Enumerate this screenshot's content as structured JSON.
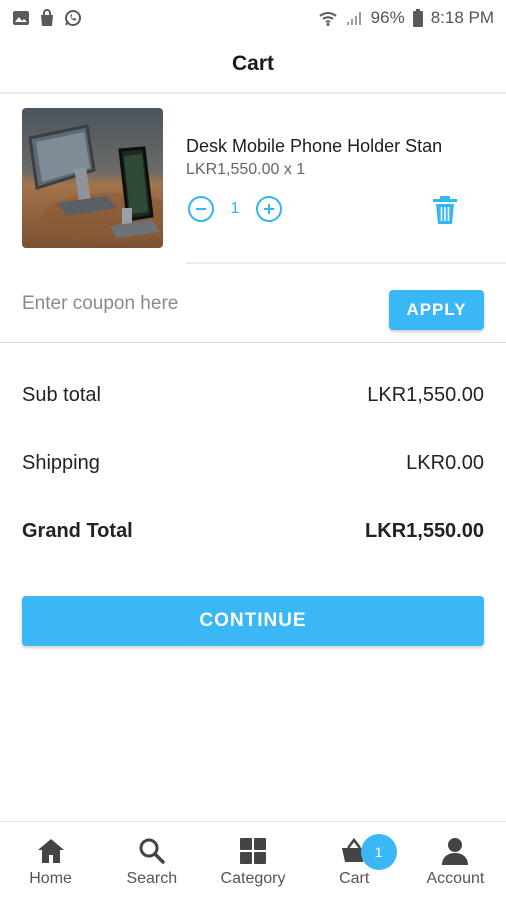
{
  "status_bar": {
    "battery": "96%",
    "time": "8:18 PM"
  },
  "header": {
    "title": "Cart"
  },
  "cart_item": {
    "name": "Desk Mobile Phone Holder Stan",
    "price_line": "LKR1,550.00 x 1",
    "quantity": "1"
  },
  "coupon": {
    "placeholder": "Enter coupon here",
    "value": "",
    "apply_label": "APPLY"
  },
  "totals": {
    "subtotal_label": "Sub total",
    "subtotal_value": "LKR1,550.00",
    "shipping_label": "Shipping",
    "shipping_value": "LKR0.00",
    "grand_label": "Grand Total",
    "grand_value": "LKR1,550.00"
  },
  "continue_label": "CONTINUE",
  "bottom_nav": {
    "items": [
      {
        "label": "Home",
        "icon": "home-icon"
      },
      {
        "label": "Search",
        "icon": "search-icon"
      },
      {
        "label": "Category",
        "icon": "grid-icon"
      },
      {
        "label": "Cart",
        "icon": "basket-icon"
      },
      {
        "label": "Account",
        "icon": "person-icon"
      }
    ],
    "cart_badge": "1"
  },
  "colors": {
    "accent": "#3ab8f6",
    "text": "#222222",
    "muted": "#666666"
  }
}
